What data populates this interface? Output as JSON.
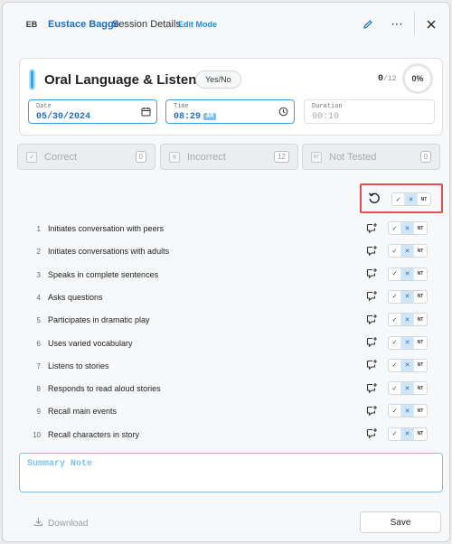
{
  "header": {
    "avatar_initials": "EB",
    "student_name": "Eustace Bagge",
    "session_title": "Session Details",
    "mode_label": "Edit Mode",
    "edit_icon": "pencil-icon",
    "more_icon": "ellipsis-icon",
    "close_icon": "close-icon"
  },
  "subject": {
    "title": "Oral Language & Listening",
    "type": "Yes/No",
    "score": "0",
    "score_total": "/12",
    "percent": "0%",
    "date_label": "Date",
    "date_value": "05/30/2024",
    "time_label": "Time",
    "time_value": "08:29",
    "time_ampm": "AM",
    "duration_label": "Duration",
    "duration_value": "00:10"
  },
  "summary_buttons": [
    {
      "label": "Correct",
      "count": "0"
    },
    {
      "label": "Incorrect",
      "count": "12"
    },
    {
      "label": "Not Tested",
      "count": "0"
    }
  ],
  "answer_options": {
    "correct": "✓",
    "incorrect": "✕",
    "not_tested": "NT"
  },
  "items": [
    {
      "num": "1",
      "label": "Initiates conversation with peers"
    },
    {
      "num": "2",
      "label": "Initiates conversations with adults"
    },
    {
      "num": "3",
      "label": "Speaks in complete sentences"
    },
    {
      "num": "4",
      "label": "Asks questions"
    },
    {
      "num": "5",
      "label": "Participates in dramatic play"
    },
    {
      "num": "6",
      "label": "Uses varied vocabulary"
    },
    {
      "num": "7",
      "label": "Listens to stories"
    },
    {
      "num": "8",
      "label": "Responds to read aloud stories"
    },
    {
      "num": "9",
      "label": "Recall main events"
    },
    {
      "num": "10",
      "label": "Recall characters in story"
    }
  ],
  "note": {
    "placeholder": "Summary Note"
  },
  "footer": {
    "download_label": "Download",
    "save_label": "Save"
  },
  "colors": {
    "accent": "#1e6fc2",
    "highlight_border": "#e05050",
    "selected_incorrect": "#cfe6f8"
  }
}
